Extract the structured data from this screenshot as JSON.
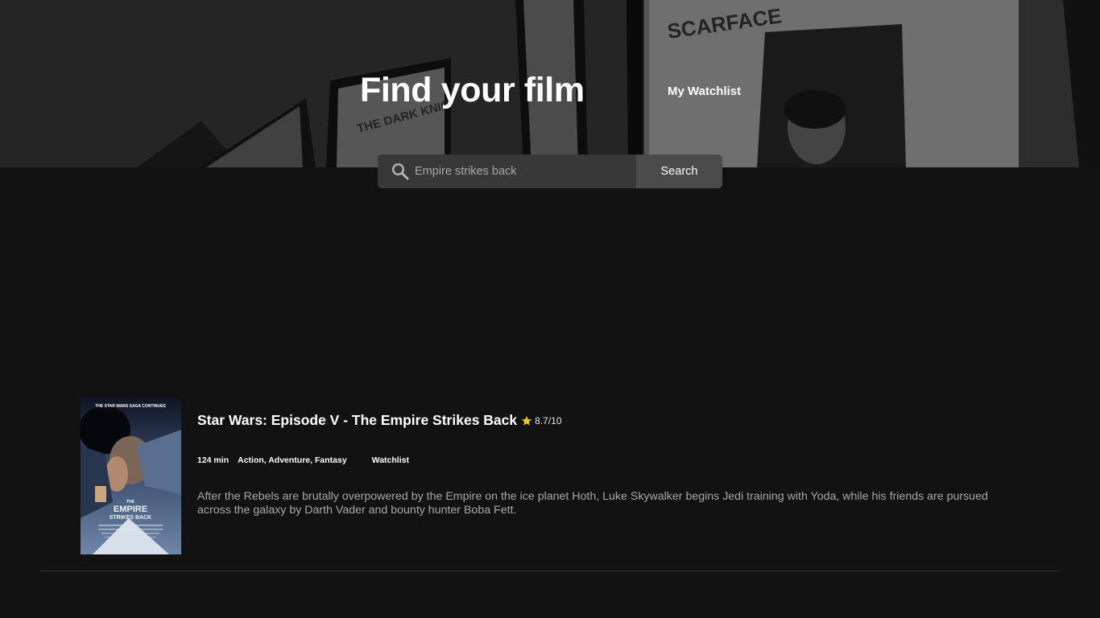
{
  "hero": {
    "title": "Find your film",
    "watchlist_link": "My Watchlist"
  },
  "search": {
    "value": "",
    "placeholder": "Empire strikes back",
    "button_label": "Search",
    "icon": "search-icon"
  },
  "results": [
    {
      "title": "Star Wars: Episode V - The Empire Strikes Back",
      "rating": "8.7/10",
      "runtime": "124 min",
      "genres": "Action, Adventure, Fantasy",
      "watchlist_label": "Watchlist",
      "overview": "After the Rebels are brutally overpowered by the Empire on the ice planet Hoth, Luke Skywalker begins Jedi training with Yoda, while his friends are pursued across the galaxy by Darth Vader and bounty hunter Boba Fett.",
      "poster": {
        "tagline": "THE STAR WARS SAGA CONTINUES",
        "logo_line1": "THE",
        "logo_line2": "EMPIRE",
        "logo_line3": "STRIKES BACK"
      }
    }
  ],
  "colors": {
    "background": "#121212",
    "search_field": "#383838",
    "search_button": "#4b4b4b",
    "star": "#f5c518",
    "overview_text": "#a8a8a8",
    "divider": "#2e2e2e"
  }
}
